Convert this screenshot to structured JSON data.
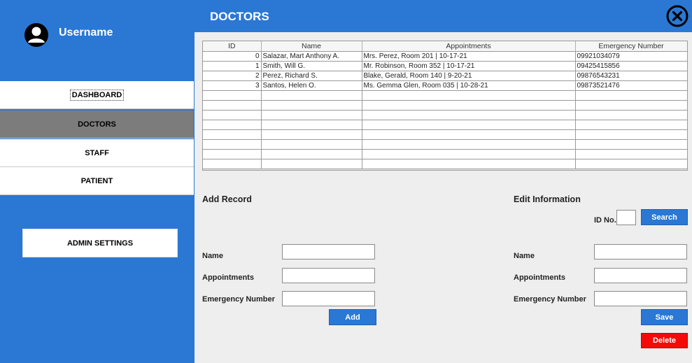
{
  "sidebar": {
    "username": "Username",
    "nav": {
      "dashboard": "DASHBOARD",
      "doctors": "DOCTORS",
      "staff": "STAFF",
      "patient": "PATIENT"
    },
    "admin_settings": "ADMIN SETTINGS"
  },
  "header": {
    "title": "DOCTORS"
  },
  "table": {
    "columns": [
      "ID",
      "Name",
      "Appointments",
      "Emergency Number"
    ],
    "rows": [
      [
        "0",
        "Salazar, Mart Anthony A.",
        "Mrs. Perez, Room 201 | 10-17-21",
        "09921034079"
      ],
      [
        "1",
        "Smith, Will G.",
        "Mr. Robinson, Room 352 | 10-17-21",
        "09425415856"
      ],
      [
        "2",
        "Perez, Richard S.",
        "Blake, Gerald, Room 140 | 9-20-21",
        "09876543231"
      ],
      [
        "3",
        "Santos, Helen O.",
        "Ms. Gemma Glen, Room 035 | 10-28-21",
        "09873521476"
      ],
      [
        "",
        "",
        "",
        ""
      ],
      [
        "",
        "",
        "",
        ""
      ],
      [
        "",
        "",
        "",
        ""
      ],
      [
        "",
        "",
        "",
        ""
      ],
      [
        "",
        "",
        "",
        ""
      ],
      [
        "",
        "",
        "",
        ""
      ],
      [
        "",
        "",
        "",
        ""
      ],
      [
        "",
        "",
        "",
        ""
      ]
    ]
  },
  "add_record": {
    "title": "Add Record",
    "name_label": "Name",
    "name_value": "",
    "appointments_label": "Appointments",
    "appointments_value": "",
    "emergency_label": "Emergency Number",
    "emergency_value": "",
    "add_button": "Add"
  },
  "edit_info": {
    "title": "Edit Information",
    "id_label": "ID No.",
    "id_value": "",
    "search_button": "Search",
    "name_label": "Name",
    "name_value": "",
    "appointments_label": "Appointments",
    "appointments_value": "",
    "emergency_label": "Emergency Number",
    "emergency_value": "",
    "save_button": "Save",
    "delete_button": "Delete"
  },
  "colors": {
    "accent": "#2a78d4",
    "active_nav": "#7c7c7c",
    "danger": "#f50a0a"
  },
  "icons": {
    "avatar": "user-avatar-icon",
    "close": "close-circle-icon"
  }
}
